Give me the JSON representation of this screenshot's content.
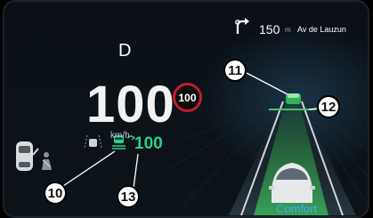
{
  "cluster": {
    "gear": "D",
    "speed": "100",
    "speed_unit": "km/h",
    "speed_limit": "100",
    "acc_set_speed": "100",
    "drive_mode": "Comfort"
  },
  "navigation": {
    "distance": "150",
    "distance_unit": "m",
    "street": "Av de Lauzun",
    "icon": "turn-right-arrow-icon"
  },
  "callouts": {
    "c10": "10",
    "c11": "11",
    "c12": "12",
    "c13": "13"
  },
  "colors": {
    "accent_green": "#27d18e",
    "lane_green": "#2f8f4a",
    "mode_blue": "#3fa9ff",
    "limit_red": "#c01e2e"
  }
}
